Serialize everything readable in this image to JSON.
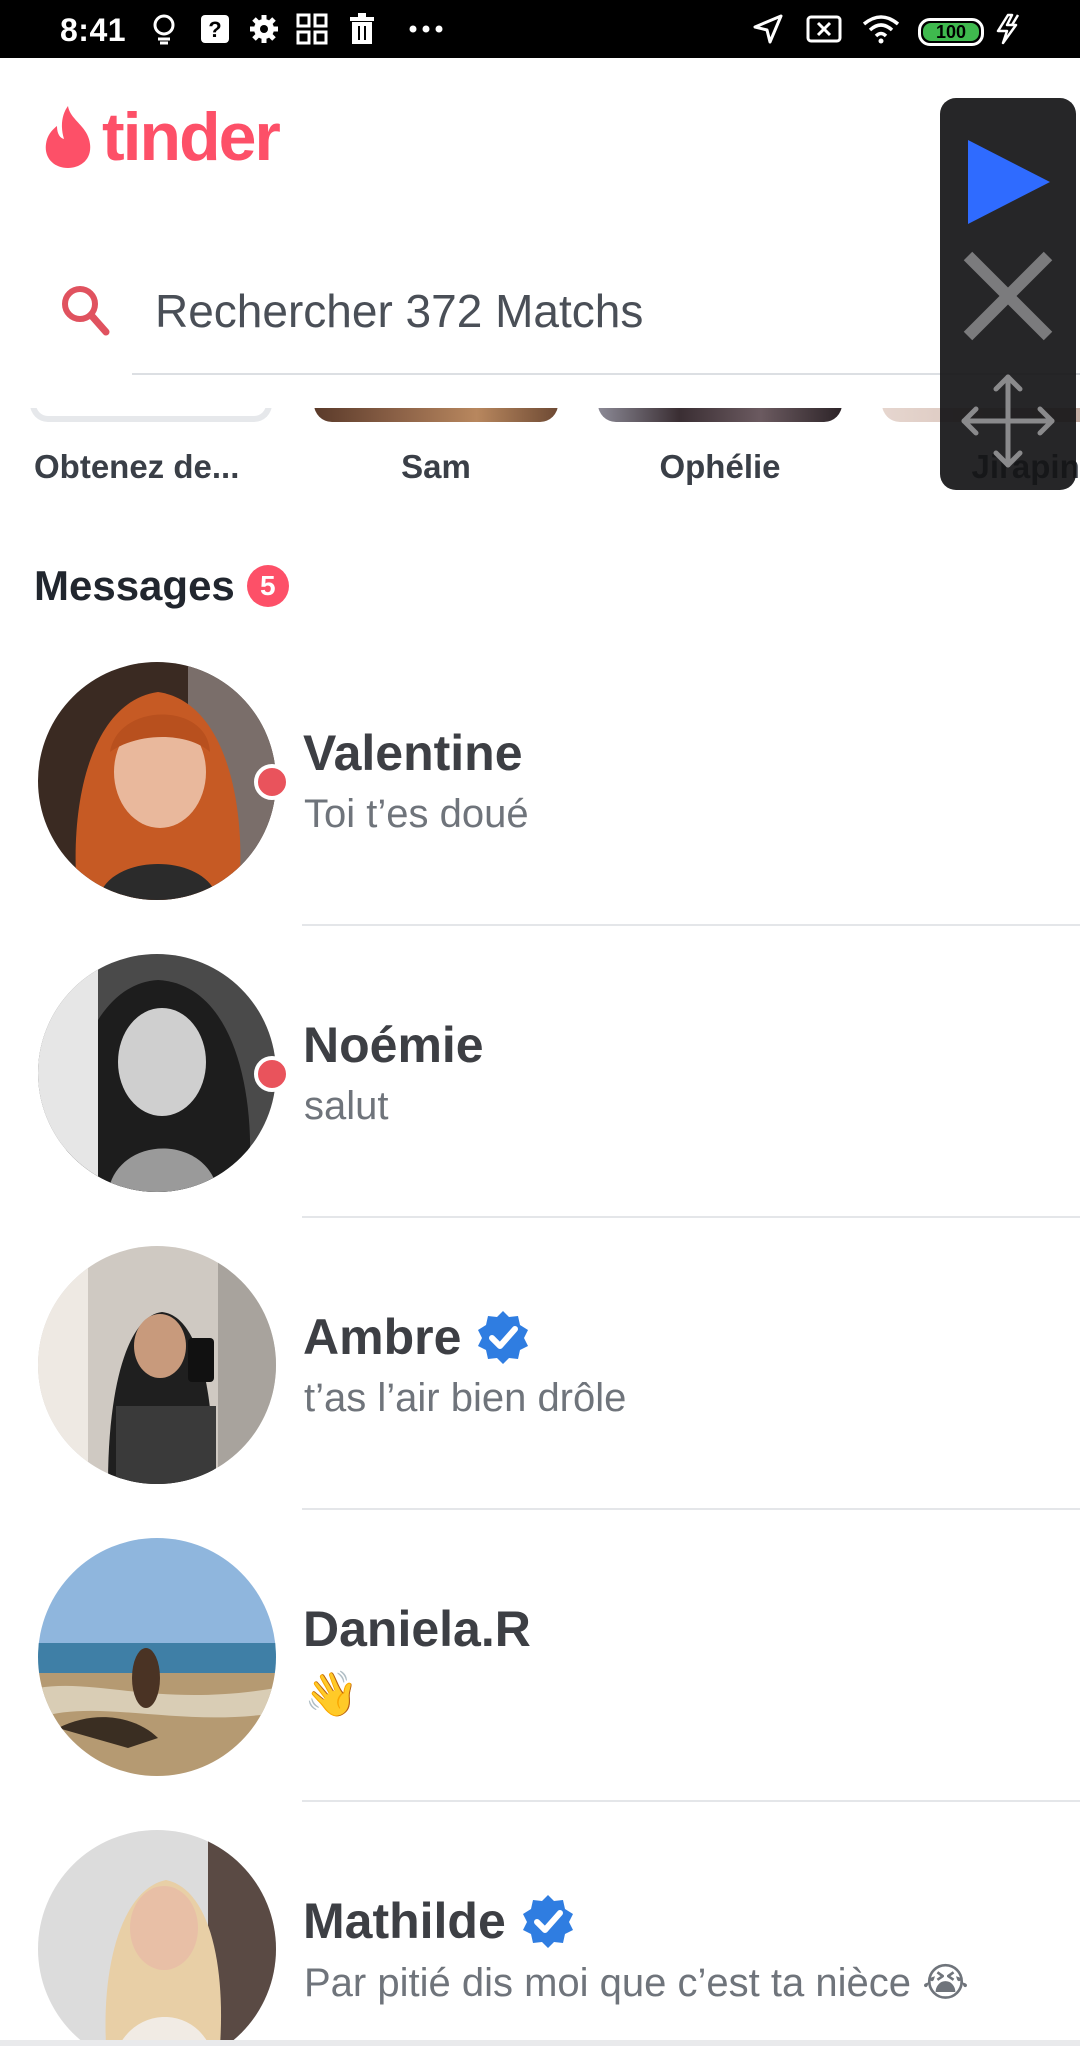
{
  "status_bar": {
    "time": "8:41",
    "battery": "100",
    "icons": [
      "lightbulb-icon",
      "help-box-icon",
      "gear-icon",
      "apps-grid-icon",
      "trash-icon",
      "more-dots-icon",
      "location-arrow-icon",
      "sim-off-icon",
      "wifi-icon",
      "battery-icon",
      "charging-icon"
    ]
  },
  "header": {
    "logo_text": "tinder",
    "brand_color": "#fd5068"
  },
  "search": {
    "placeholder": "Rechercher 372 Matchs"
  },
  "matches": [
    {
      "label": "Obtenez de..."
    },
    {
      "label": "Sam"
    },
    {
      "label": "Ophélie"
    },
    {
      "label": "Jirapinya"
    }
  ],
  "messages": {
    "title": "Messages",
    "count": "5",
    "items": [
      {
        "name": "Valentine",
        "preview": "Toi t’es doué",
        "unread": true,
        "verified": false
      },
      {
        "name": "Noémie",
        "preview": "salut",
        "unread": true,
        "verified": false
      },
      {
        "name": "Ambre",
        "preview": "t’as l’air bien drôle",
        "unread": false,
        "verified": true
      },
      {
        "name": "Daniela.R",
        "preview": "👋",
        "unread": false,
        "verified": false
      },
      {
        "name": "Mathilde",
        "preview": "Par pitié dis moi que c’est ta nièce 😭",
        "unread": false,
        "verified": true
      }
    ]
  },
  "overlay": {
    "icons": [
      "play-icon",
      "close-icon",
      "move-icon"
    ],
    "play_color": "#2f6bff"
  }
}
